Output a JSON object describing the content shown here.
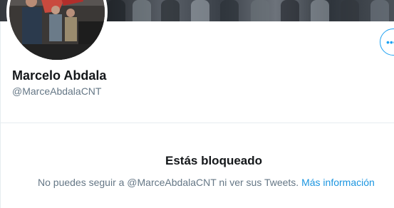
{
  "profile": {
    "display_name": "Marcelo Abdala",
    "screen_name": "@MarceAbdalaCNT",
    "more_icon": "more-dots-icon",
    "colors": {
      "accent": "#1da1f2",
      "primary_text": "#14171a",
      "secondary_text": "#657786"
    }
  },
  "blocked": {
    "title": "Estás bloqueado",
    "message": "No puedes seguir a @MarceAbdalaCNT ni ver sus Tweets.",
    "learn_more_label": "Más información"
  }
}
